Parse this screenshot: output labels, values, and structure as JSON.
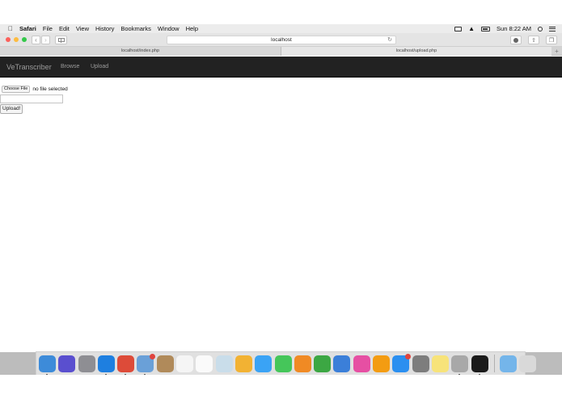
{
  "menubar": {
    "app_name": "Safari",
    "items": [
      "File",
      "Edit",
      "View",
      "History",
      "Bookmarks",
      "Window",
      "Help"
    ],
    "clock": "Sun 8:22 AM",
    "icons": [
      "airplay-icon",
      "wifi-icon",
      "battery-icon",
      "spotlight-icon",
      "notification-center-icon"
    ]
  },
  "toolbar": {
    "address": "localhost",
    "icons": [
      "back-icon",
      "forward-icon",
      "sidebar-icon",
      "reload-icon",
      "download-icon",
      "share-icon",
      "tabs-overview-icon"
    ]
  },
  "tabs": [
    {
      "label": "localhost/index.php",
      "active": false
    },
    {
      "label": "localhost/upload.php",
      "active": true
    }
  ],
  "new_tab_label": "+",
  "page": {
    "brand": "VeTranscriber",
    "nav": [
      "Browse",
      "Upload"
    ],
    "choose_file_label": "Choose File",
    "file_status": "no file selected",
    "text_input_value": "",
    "upload_button": "Upload!"
  },
  "dock": {
    "icons": [
      {
        "name": "finder-icon",
        "color": "#3d8bd9",
        "running": true,
        "badge": false
      },
      {
        "name": "siri-icon",
        "color": "#5a4fcf",
        "running": false,
        "badge": false
      },
      {
        "name": "launchpad-icon",
        "color": "#8e8e93",
        "running": false,
        "badge": false
      },
      {
        "name": "safari-icon",
        "color": "#1e7fe0",
        "running": true,
        "badge": false
      },
      {
        "name": "chrome-icon",
        "color": "#dd4b39",
        "running": true,
        "badge": false
      },
      {
        "name": "mail-icon",
        "color": "#6aa0d8",
        "running": true,
        "badge": true
      },
      {
        "name": "contacts-icon",
        "color": "#b08a5a",
        "running": false,
        "badge": false
      },
      {
        "name": "calendar-icon",
        "color": "#f5f5f5",
        "running": false,
        "badge": false
      },
      {
        "name": "reminders-icon",
        "color": "#fafafa",
        "running": false,
        "badge": false
      },
      {
        "name": "preview-icon",
        "color": "#c9ddea",
        "running": false,
        "badge": false
      },
      {
        "name": "photos-icon",
        "color": "#f2b233",
        "running": false,
        "badge": false
      },
      {
        "name": "messages-icon",
        "color": "#3aa3f5",
        "running": false,
        "badge": false
      },
      {
        "name": "facetime-icon",
        "color": "#45c65a",
        "running": false,
        "badge": false
      },
      {
        "name": "pages-icon",
        "color": "#f08a24",
        "running": false,
        "badge": false
      },
      {
        "name": "numbers-icon",
        "color": "#3ca743",
        "running": false,
        "badge": false
      },
      {
        "name": "keynote-icon",
        "color": "#3b7fd9",
        "running": false,
        "badge": false
      },
      {
        "name": "itunes-icon",
        "color": "#e64fa3",
        "running": false,
        "badge": false
      },
      {
        "name": "ibooks-icon",
        "color": "#f39c12",
        "running": false,
        "badge": false
      },
      {
        "name": "app-store-icon",
        "color": "#2b8ff0",
        "running": false,
        "badge": true
      },
      {
        "name": "system-preferences-icon",
        "color": "#7d7d7d",
        "running": false,
        "badge": false
      },
      {
        "name": "notes-icon",
        "color": "#f7e37a",
        "running": false,
        "badge": false
      },
      {
        "name": "disk-utility-icon",
        "color": "#a8a8a8",
        "running": true,
        "badge": false
      },
      {
        "name": "terminal-icon",
        "color": "#1b1b1b",
        "running": true,
        "badge": false
      }
    ],
    "trailing_icons": [
      {
        "name": "downloads-folder-icon",
        "color": "#74b5ea"
      },
      {
        "name": "trash-icon",
        "color": "#d9d9d9"
      }
    ]
  }
}
